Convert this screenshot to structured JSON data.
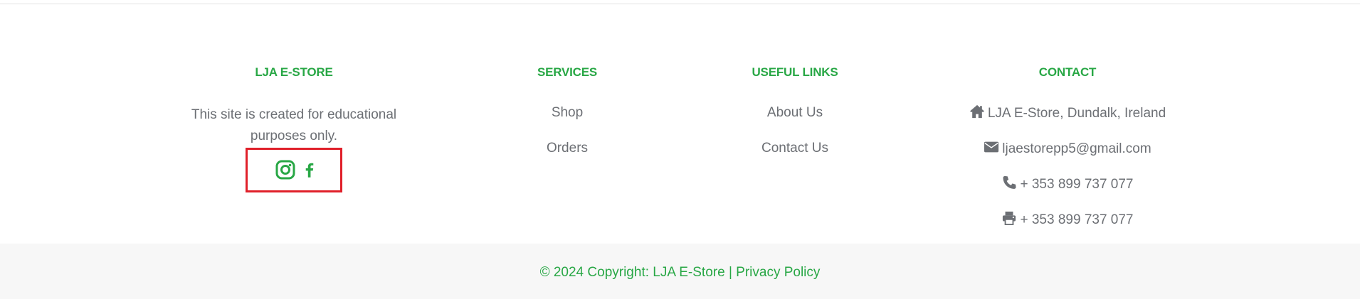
{
  "footer": {
    "brand": {
      "heading": "LJA E-STORE",
      "description": "This site is created for educational purposes only.",
      "social": [
        {
          "icon": "instagram-icon"
        },
        {
          "icon": "facebook-icon"
        }
      ]
    },
    "services": {
      "heading": "SERVICES",
      "links": [
        "Shop",
        "Orders"
      ]
    },
    "useful_links": {
      "heading": "USEFUL LINKS",
      "links": [
        "About Us",
        "Contact Us"
      ]
    },
    "contact": {
      "heading": "CONTACT",
      "address": "LJA E-Store, Dundalk, Ireland",
      "email": "ljaestorepp5@gmail.com",
      "phone": "+ 353 899 737 077",
      "fax": "+ 353 899 737 077"
    },
    "copyright": {
      "text": "© 2024 Copyright: LJA E-Store |",
      "policy_link": "Privacy Policy"
    }
  },
  "colors": {
    "accent": "#28a745",
    "text": "#6c6f74",
    "highlight_box": "#e0202a",
    "bottom_bar": "#f7f7f7"
  }
}
